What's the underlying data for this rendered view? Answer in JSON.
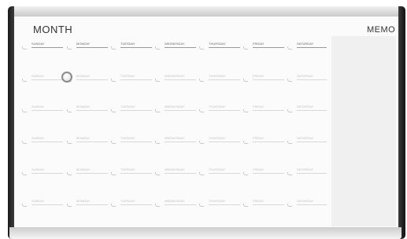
{
  "board": {
    "title": "MONTH",
    "memo_label": "MEMO",
    "days": [
      "SUNDAY",
      "MONDAY",
      "TUESDAY",
      "WEDNESDAY",
      "THURSDAY",
      "FRIDAY",
      "SATURDAY"
    ]
  },
  "colors": {
    "frame_dark": "#1b1b1b",
    "frame_silver": "#cdcdcd",
    "board_white": "#fbfbfb",
    "memo_panel": "#f0f0f0",
    "magnet_ring": "#8c8c8c"
  }
}
